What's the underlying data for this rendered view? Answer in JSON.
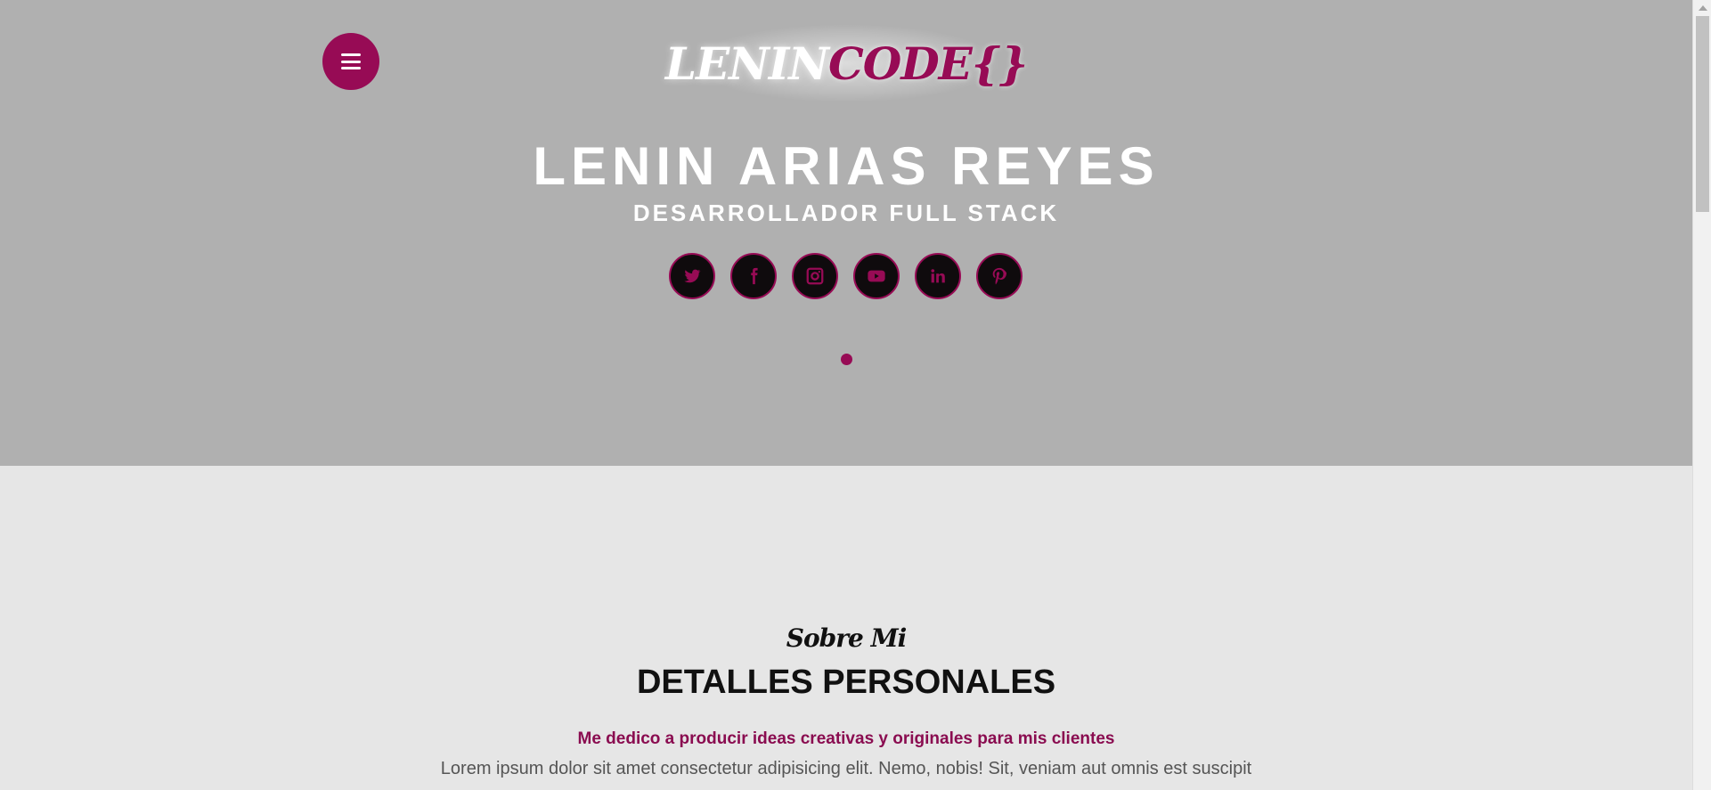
{
  "brand": {
    "logo_part_white": "LENIN",
    "logo_part_accent": "CODE{}"
  },
  "hero": {
    "name": "LENIN ARIAS REYES",
    "role": "DESARROLLADOR FULL STACK",
    "menu_icon": "hamburger-icon"
  },
  "socials": [
    {
      "icon": "twitter-icon"
    },
    {
      "icon": "facebook-icon"
    },
    {
      "icon": "instagram-icon"
    },
    {
      "icon": "youtube-icon"
    },
    {
      "icon": "linkedin-icon"
    },
    {
      "icon": "pinterest-icon"
    }
  ],
  "about": {
    "kicker": "Sobre Mi",
    "title": "DETALLES PERSONALES",
    "lead": "Me dedico a producir ideas creativas y originales para mis clientes",
    "body": "Lorem ipsum dolor sit amet consectetur adipisicing elit. Nemo, nobis! Sit, veniam aut omnis est suscipit"
  },
  "colors": {
    "accent": "#970b55",
    "hero_bg": "#b0b0b0",
    "section_bg": "#e6e6e6",
    "social_bg": "#0f0b0d"
  }
}
